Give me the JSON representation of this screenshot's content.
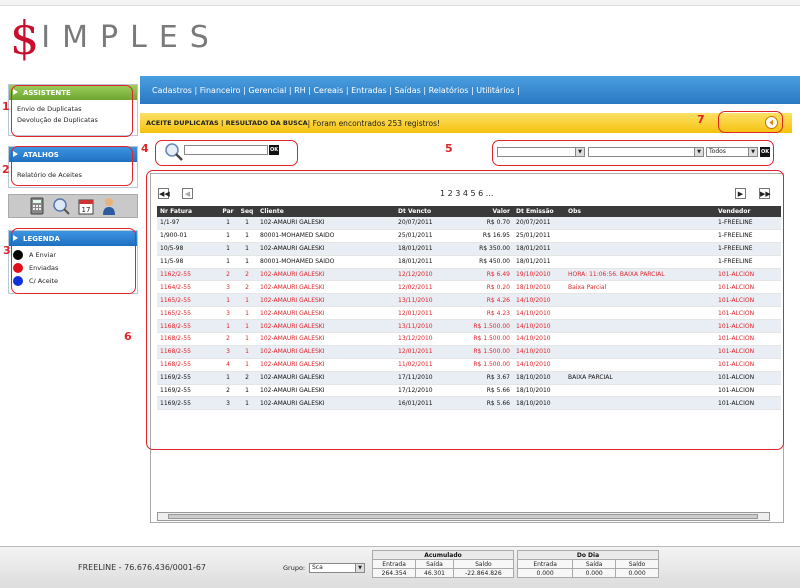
{
  "app": {
    "logo_dollar": "$",
    "logo_rest": "IMPLES"
  },
  "nav": {
    "text": "Cadastros | Financeiro | Gerencial | RH | Cereais | Entradas | Saídas | Relatórios | Utilitários |"
  },
  "sidebar": {
    "assistente": {
      "title": "ASSISTENTE",
      "items": [
        "Envio de Duplicatas",
        "Devolução de Duplicatas"
      ]
    },
    "atalhos": {
      "title": "ATALHOS",
      "items": [
        "Relatório de Aceites"
      ]
    },
    "legenda": {
      "title": "LEGENDA",
      "items": [
        "A Enviar",
        "Enviadas",
        "C/ Aceite"
      ]
    }
  },
  "colors": {
    "legend_a_enviar": "#000000",
    "legend_enviadas": "#e0101a",
    "legend_aceite": "#1030d8"
  },
  "status": {
    "title": "ACEITE DUPLICATAS | RESULTADO DA BUSCA",
    "message": " | Foram encontrados 253 registros!"
  },
  "search": {
    "ok_label": "OK"
  },
  "filters": {
    "third_value": "Todos",
    "ok_label": "OK"
  },
  "annotations": [
    "1",
    "2",
    "3",
    "4",
    "5",
    "6",
    "7"
  ],
  "pagination": {
    "pages": "1 2 3 4 5 6 ...",
    "first": "◀◀",
    "prev": "◀",
    "next": "▶",
    "last": "▶▶"
  },
  "table": {
    "columns": [
      "Nr Fatura",
      "Par",
      "Seq",
      "Cliente",
      "Dt Vencto",
      "Valor",
      "Dt Emissão",
      "Obs",
      "Vendedor"
    ],
    "rows": [
      {
        "c": [
          "1/1-97",
          "1",
          "1",
          "102-AMAURI GALESKI",
          "20/07/2011",
          "R$ 0.70",
          "20/07/2011",
          "",
          "1-FREELINE"
        ],
        "s": "black"
      },
      {
        "c": [
          "1/900-01",
          "1",
          "1",
          "80001-MOHAMED SAIDO",
          "25/01/2011",
          "R$ 16.95",
          "25/01/2011",
          "",
          "1-FREELINE"
        ],
        "s": "black"
      },
      {
        "c": [
          "10/5-98",
          "1",
          "1",
          "102-AMAURI GALESKI",
          "18/01/2011",
          "R$ 350.00",
          "18/01/2011",
          "",
          "1-FREELINE"
        ],
        "s": "black"
      },
      {
        "c": [
          "11/5-98",
          "1",
          "1",
          "80001-MOHAMED SAIDO",
          "18/01/2011",
          "R$ 450.00",
          "18/01/2011",
          "",
          "1-FREELINE"
        ],
        "s": "black"
      },
      {
        "c": [
          "1162/2-55",
          "2",
          "2",
          "102-AMAURI GALESKI",
          "12/12/2010",
          "R$ 6.49",
          "19/10/2010",
          "HORA: 11:06:56. BAIXA PARCIAL",
          "101-ALCION"
        ],
        "s": "red"
      },
      {
        "c": [
          "1164/2-55",
          "3",
          "2",
          "102-AMAURI GALESKI",
          "12/02/2011",
          "R$ 0.20",
          "18/10/2010",
          "Baixa Parcial",
          "101-ALCION"
        ],
        "s": "red"
      },
      {
        "c": [
          "1165/2-55",
          "1",
          "1",
          "102-AMAURI GALESKI",
          "13/11/2010",
          "R$ 4.26",
          "14/10/2010",
          "",
          "101-ALCION"
        ],
        "s": "red"
      },
      {
        "c": [
          "1165/2-55",
          "3",
          "1",
          "102-AMAURI GALESKI",
          "12/01/2011",
          "R$ 4.23",
          "14/10/2010",
          "",
          "101-ALCION"
        ],
        "s": "red"
      },
      {
        "c": [
          "1168/2-55",
          "1",
          "1",
          "102-AMAURI GALESKI",
          "13/11/2010",
          "R$ 1.500.00",
          "14/10/2010",
          "",
          "101-ALCION"
        ],
        "s": "red"
      },
      {
        "c": [
          "1168/2-55",
          "2",
          "1",
          "102-AMAURI GALESKI",
          "13/12/2010",
          "R$ 1.500.00",
          "14/10/2010",
          "",
          "101-ALCION"
        ],
        "s": "red"
      },
      {
        "c": [
          "1168/2-55",
          "3",
          "1",
          "102-AMAURI GALESKI",
          "12/01/2011",
          "R$ 1.500.00",
          "14/10/2010",
          "",
          "101-ALCION"
        ],
        "s": "red"
      },
      {
        "c": [
          "1168/2-55",
          "4",
          "1",
          "102-AMAURI GALESKI",
          "11/02/2011",
          "R$ 1.500.00",
          "14/10/2010",
          "",
          "101-ALCION"
        ],
        "s": "red"
      },
      {
        "c": [
          "1169/2-55",
          "1",
          "2",
          "102-AMAURI GALESKI",
          "17/11/2010",
          "R$ 3.67",
          "18/10/2010",
          "BAIXA PARCIAL",
          "101-ALCION"
        ],
        "s": "black"
      },
      {
        "c": [
          "1169/2-55",
          "2",
          "1",
          "102-AMAURI GALESKI",
          "17/12/2010",
          "R$ 5.66",
          "18/10/2010",
          "",
          "101-ALCION"
        ],
        "s": "black"
      },
      {
        "c": [
          "1169/2-55",
          "3",
          "1",
          "102-AMAURI GALESKI",
          "16/01/2011",
          "R$ 5.66",
          "18/10/2010",
          "",
          "101-ALCION"
        ],
        "s": "black"
      }
    ]
  },
  "footer": {
    "company": "FREELINE - 76.676.436/0001-67",
    "grupo_label": "Grupo:",
    "grupo_value": "Sca",
    "acumulado": {
      "title": "Acumulado",
      "headers": [
        "Entrada",
        "Saída",
        "Saldo"
      ],
      "values": [
        "264.354",
        "46.301",
        "-22.864.826"
      ]
    },
    "dodia": {
      "title": "Do Dia",
      "headers": [
        "Entrada",
        "Saída",
        "Saldo"
      ],
      "values": [
        "0.000",
        "0.000",
        "0.000"
      ]
    }
  }
}
